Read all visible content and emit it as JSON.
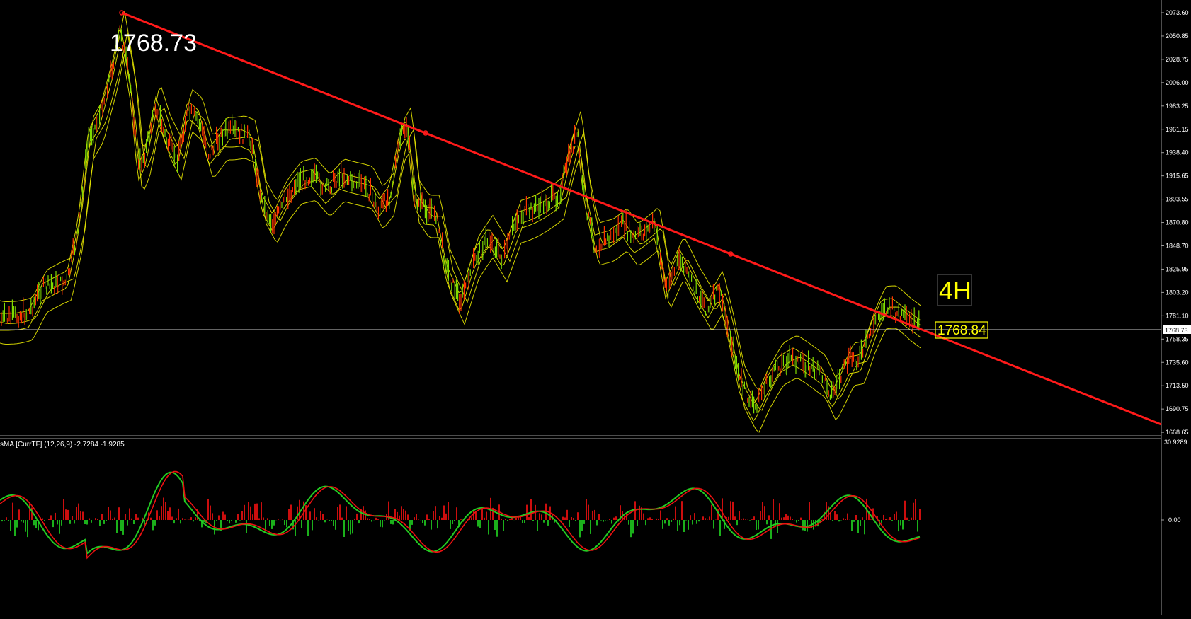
{
  "main_price_label": "1768.73",
  "timeframe_label": "4H",
  "current_price_tag": "1768.84",
  "price_axis": {
    "ticks": [
      "2073.60",
      "2050.85",
      "2028.75",
      "2006.00",
      "1983.25",
      "1961.15",
      "1938.40",
      "1915.65",
      "1893.55",
      "1870.80",
      "1848.70",
      "1825.95",
      "1803.20",
      "1781.10",
      "1758.35",
      "1735.60",
      "1713.50",
      "1690.75",
      "1668.65"
    ],
    "current_value": "1768.73"
  },
  "indicator": {
    "header": "sMA [CurrTF] (12,26,9) -2.7284 -1.9285",
    "axis_top": "30.9289",
    "axis_zero": "0.00"
  },
  "colors": {
    "background": "#000000",
    "trendline": "#ff1a1a",
    "bands": "#e8e800",
    "candle_up": "#7fdc00",
    "candle_down": "#ff3300",
    "macd_line": "#22cc22",
    "signal_line": "#ee1111",
    "hist_pos": "#ff1111",
    "hist_neg": "#22dd22"
  }
}
